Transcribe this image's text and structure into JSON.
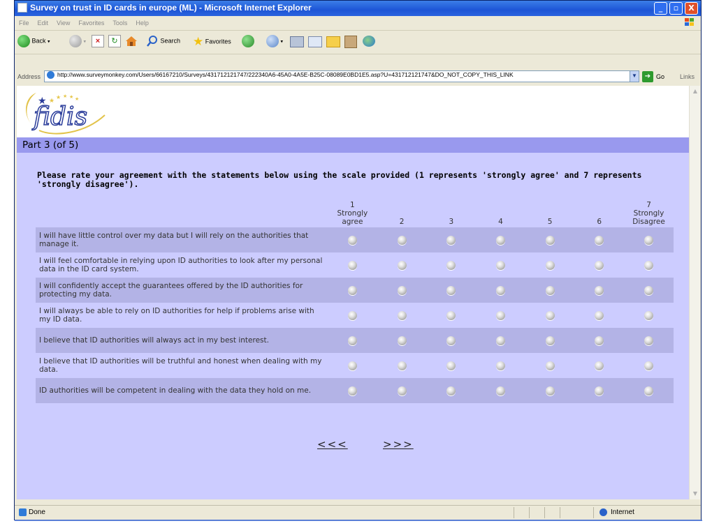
{
  "window": {
    "title": "Survey on trust in ID cards in europe (ML) - Microsoft Internet Explorer",
    "controls": {
      "minimize": "_",
      "maximize": "▫",
      "close": "X"
    }
  },
  "menu": [
    "File",
    "Edit",
    "View",
    "Favorites",
    "Tools",
    "Help"
  ],
  "toolbar": {
    "back": "Back",
    "search": "Search",
    "favorites": "Favorites"
  },
  "address": {
    "label": "Address",
    "url": "http://www.surveymonkey.com/Users/66167210/Surveys/431712121747/222340A6-45A0-4A5E-B25C-08089E0BD1E5.asp?U=431712121747&DO_NOT_COPY_THIS_LINK",
    "go": "Go",
    "links": "Links"
  },
  "page": {
    "logo_text": "fidis",
    "part_title": "Part 3 (of 5)",
    "question": "Please rate your agreement with the statements below using the scale provided (1 represents 'strongly agree' and 7 represents 'strongly disagree').",
    "scale": [
      [
        "1",
        "Strongly",
        "agree"
      ],
      [
        "2"
      ],
      [
        "3"
      ],
      [
        "4"
      ],
      [
        "5"
      ],
      [
        "6"
      ],
      [
        "7",
        "Strongly",
        "Disagree"
      ]
    ],
    "statements": [
      "I will have little control over my data but I will rely on the authorities that manage it.",
      "I will feel comfortable in relying upon ID authorities to look after my personal data in the ID card system.",
      "I will confidently accept the guarantees offered by the ID authorities for protecting my data.",
      "I will always be able to rely on ID authorities for help if problems arise with my ID data.",
      "I believe that ID authorities will always act in my best interest.",
      "I believe that ID authorities will be truthful and honest when dealing with my data.",
      "ID authorities will be competent in dealing with the data they hold on me."
    ],
    "prev": "<<<",
    "next": ">>>"
  },
  "status": {
    "text": "Done",
    "zone": "Internet"
  },
  "colors": {
    "page_bg": "#ccccff",
    "part_bar": "#9999ee",
    "row_band": "#b3b3e6",
    "title_bar": "#1d55d6"
  }
}
